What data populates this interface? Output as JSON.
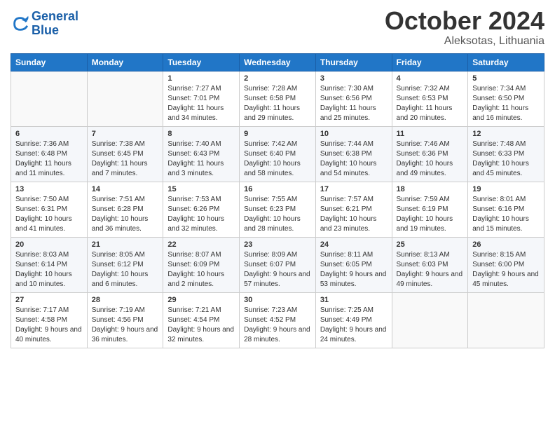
{
  "header": {
    "logo_line1": "General",
    "logo_line2": "Blue",
    "month": "October 2024",
    "location": "Aleksotas, Lithuania"
  },
  "weekdays": [
    "Sunday",
    "Monday",
    "Tuesday",
    "Wednesday",
    "Thursday",
    "Friday",
    "Saturday"
  ],
  "weeks": [
    [
      {
        "day": "",
        "sunrise": "",
        "sunset": "",
        "daylight": ""
      },
      {
        "day": "",
        "sunrise": "",
        "sunset": "",
        "daylight": ""
      },
      {
        "day": "1",
        "sunrise": "Sunrise: 7:27 AM",
        "sunset": "Sunset: 7:01 PM",
        "daylight": "Daylight: 11 hours and 34 minutes."
      },
      {
        "day": "2",
        "sunrise": "Sunrise: 7:28 AM",
        "sunset": "Sunset: 6:58 PM",
        "daylight": "Daylight: 11 hours and 29 minutes."
      },
      {
        "day": "3",
        "sunrise": "Sunrise: 7:30 AM",
        "sunset": "Sunset: 6:56 PM",
        "daylight": "Daylight: 11 hours and 25 minutes."
      },
      {
        "day": "4",
        "sunrise": "Sunrise: 7:32 AM",
        "sunset": "Sunset: 6:53 PM",
        "daylight": "Daylight: 11 hours and 20 minutes."
      },
      {
        "day": "5",
        "sunrise": "Sunrise: 7:34 AM",
        "sunset": "Sunset: 6:50 PM",
        "daylight": "Daylight: 11 hours and 16 minutes."
      }
    ],
    [
      {
        "day": "6",
        "sunrise": "Sunrise: 7:36 AM",
        "sunset": "Sunset: 6:48 PM",
        "daylight": "Daylight: 11 hours and 11 minutes."
      },
      {
        "day": "7",
        "sunrise": "Sunrise: 7:38 AM",
        "sunset": "Sunset: 6:45 PM",
        "daylight": "Daylight: 11 hours and 7 minutes."
      },
      {
        "day": "8",
        "sunrise": "Sunrise: 7:40 AM",
        "sunset": "Sunset: 6:43 PM",
        "daylight": "Daylight: 11 hours and 3 minutes."
      },
      {
        "day": "9",
        "sunrise": "Sunrise: 7:42 AM",
        "sunset": "Sunset: 6:40 PM",
        "daylight": "Daylight: 10 hours and 58 minutes."
      },
      {
        "day": "10",
        "sunrise": "Sunrise: 7:44 AM",
        "sunset": "Sunset: 6:38 PM",
        "daylight": "Daylight: 10 hours and 54 minutes."
      },
      {
        "day": "11",
        "sunrise": "Sunrise: 7:46 AM",
        "sunset": "Sunset: 6:36 PM",
        "daylight": "Daylight: 10 hours and 49 minutes."
      },
      {
        "day": "12",
        "sunrise": "Sunrise: 7:48 AM",
        "sunset": "Sunset: 6:33 PM",
        "daylight": "Daylight: 10 hours and 45 minutes."
      }
    ],
    [
      {
        "day": "13",
        "sunrise": "Sunrise: 7:50 AM",
        "sunset": "Sunset: 6:31 PM",
        "daylight": "Daylight: 10 hours and 41 minutes."
      },
      {
        "day": "14",
        "sunrise": "Sunrise: 7:51 AM",
        "sunset": "Sunset: 6:28 PM",
        "daylight": "Daylight: 10 hours and 36 minutes."
      },
      {
        "day": "15",
        "sunrise": "Sunrise: 7:53 AM",
        "sunset": "Sunset: 6:26 PM",
        "daylight": "Daylight: 10 hours and 32 minutes."
      },
      {
        "day": "16",
        "sunrise": "Sunrise: 7:55 AM",
        "sunset": "Sunset: 6:23 PM",
        "daylight": "Daylight: 10 hours and 28 minutes."
      },
      {
        "day": "17",
        "sunrise": "Sunrise: 7:57 AM",
        "sunset": "Sunset: 6:21 PM",
        "daylight": "Daylight: 10 hours and 23 minutes."
      },
      {
        "day": "18",
        "sunrise": "Sunrise: 7:59 AM",
        "sunset": "Sunset: 6:19 PM",
        "daylight": "Daylight: 10 hours and 19 minutes."
      },
      {
        "day": "19",
        "sunrise": "Sunrise: 8:01 AM",
        "sunset": "Sunset: 6:16 PM",
        "daylight": "Daylight: 10 hours and 15 minutes."
      }
    ],
    [
      {
        "day": "20",
        "sunrise": "Sunrise: 8:03 AM",
        "sunset": "Sunset: 6:14 PM",
        "daylight": "Daylight: 10 hours and 10 minutes."
      },
      {
        "day": "21",
        "sunrise": "Sunrise: 8:05 AM",
        "sunset": "Sunset: 6:12 PM",
        "daylight": "Daylight: 10 hours and 6 minutes."
      },
      {
        "day": "22",
        "sunrise": "Sunrise: 8:07 AM",
        "sunset": "Sunset: 6:09 PM",
        "daylight": "Daylight: 10 hours and 2 minutes."
      },
      {
        "day": "23",
        "sunrise": "Sunrise: 8:09 AM",
        "sunset": "Sunset: 6:07 PM",
        "daylight": "Daylight: 9 hours and 57 minutes."
      },
      {
        "day": "24",
        "sunrise": "Sunrise: 8:11 AM",
        "sunset": "Sunset: 6:05 PM",
        "daylight": "Daylight: 9 hours and 53 minutes."
      },
      {
        "day": "25",
        "sunrise": "Sunrise: 8:13 AM",
        "sunset": "Sunset: 6:03 PM",
        "daylight": "Daylight: 9 hours and 49 minutes."
      },
      {
        "day": "26",
        "sunrise": "Sunrise: 8:15 AM",
        "sunset": "Sunset: 6:00 PM",
        "daylight": "Daylight: 9 hours and 45 minutes."
      }
    ],
    [
      {
        "day": "27",
        "sunrise": "Sunrise: 7:17 AM",
        "sunset": "Sunset: 4:58 PM",
        "daylight": "Daylight: 9 hours and 40 minutes."
      },
      {
        "day": "28",
        "sunrise": "Sunrise: 7:19 AM",
        "sunset": "Sunset: 4:56 PM",
        "daylight": "Daylight: 9 hours and 36 minutes."
      },
      {
        "day": "29",
        "sunrise": "Sunrise: 7:21 AM",
        "sunset": "Sunset: 4:54 PM",
        "daylight": "Daylight: 9 hours and 32 minutes."
      },
      {
        "day": "30",
        "sunrise": "Sunrise: 7:23 AM",
        "sunset": "Sunset: 4:52 PM",
        "daylight": "Daylight: 9 hours and 28 minutes."
      },
      {
        "day": "31",
        "sunrise": "Sunrise: 7:25 AM",
        "sunset": "Sunset: 4:49 PM",
        "daylight": "Daylight: 9 hours and 24 minutes."
      },
      {
        "day": "",
        "sunrise": "",
        "sunset": "",
        "daylight": ""
      },
      {
        "day": "",
        "sunrise": "",
        "sunset": "",
        "daylight": ""
      }
    ]
  ]
}
